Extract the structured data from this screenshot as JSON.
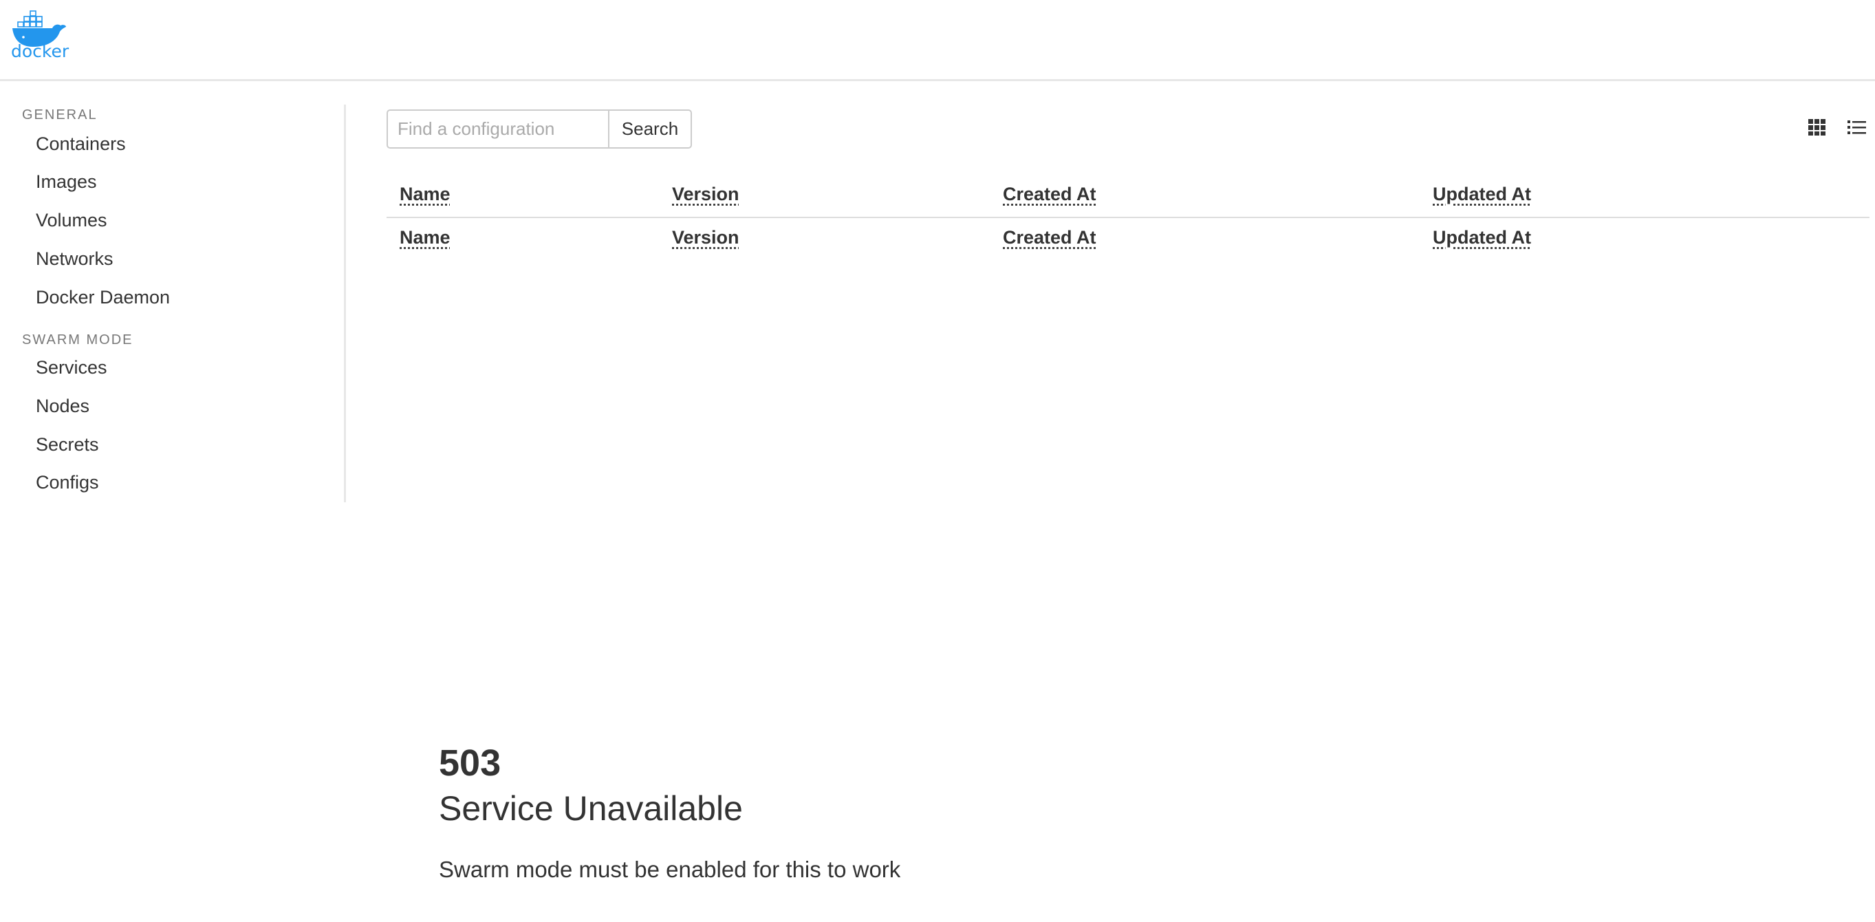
{
  "header": {
    "logo_text": "docker",
    "logo_color": "#2396ed"
  },
  "sidebar": {
    "general_heading": "GENERAL",
    "general_items": [
      {
        "label": "Containers"
      },
      {
        "label": "Images"
      },
      {
        "label": "Volumes"
      },
      {
        "label": "Networks"
      },
      {
        "label": "Docker Daemon"
      }
    ],
    "swarm_heading": "SWARM MODE",
    "swarm_items": [
      {
        "label": "Services"
      },
      {
        "label": "Nodes"
      },
      {
        "label": "Secrets"
      },
      {
        "label": "Configs"
      }
    ]
  },
  "search": {
    "placeholder": "Find a configuration",
    "value": "",
    "button_label": "Search"
  },
  "view_toggle": {
    "grid_icon": "grid-icon",
    "list_icon": "list-icon"
  },
  "table": {
    "columns": [
      "Name",
      "Version",
      "Created At",
      "Updated At"
    ]
  },
  "error": {
    "code": "503",
    "title": "Service Unavailable",
    "message": "Swarm mode must be enabled for this to work"
  }
}
